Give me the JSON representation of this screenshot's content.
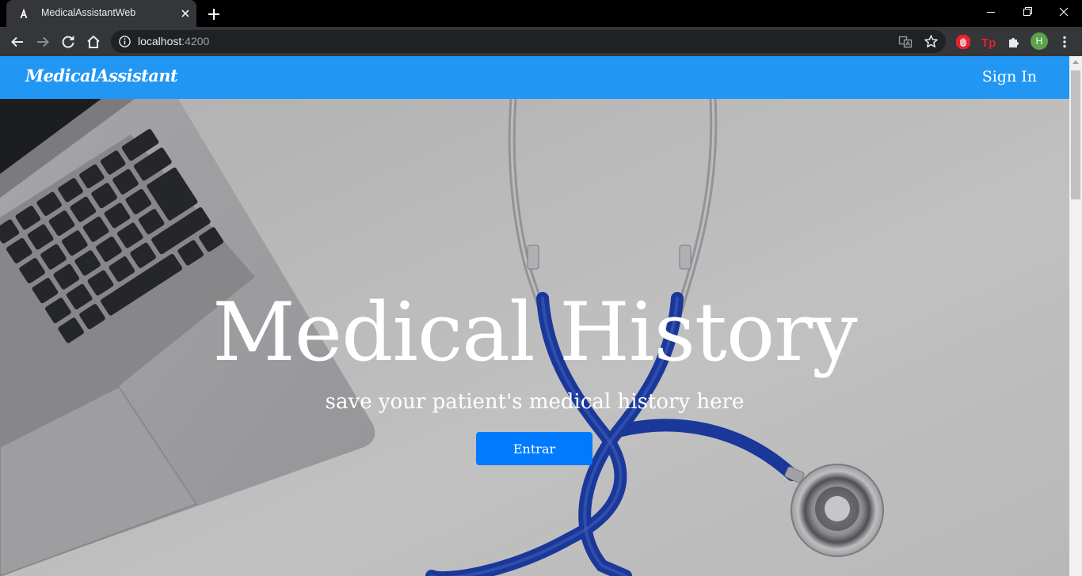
{
  "browser": {
    "tab_title": "MedicalAssistantWeb",
    "url_host": "localhost",
    "url_port": ":4200",
    "avatar_letter": "H"
  },
  "navbar": {
    "brand": "MedicalAssistant",
    "signin_label": "Sign In",
    "background_color": "#2196f3"
  },
  "hero": {
    "title": "Medical History",
    "subtitle": "save your patient's medical history here",
    "button_label": "Entrar",
    "button_color": "#007bff"
  }
}
